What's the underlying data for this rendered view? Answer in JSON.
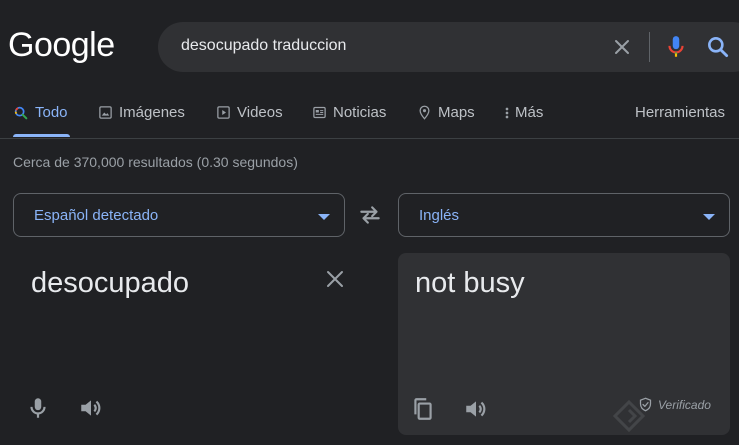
{
  "logo": {
    "text": "Google"
  },
  "search": {
    "query": "desocupado traduccion"
  },
  "tabs": [
    {
      "label": "Todo",
      "icon": "search-icon",
      "active": true
    },
    {
      "label": "Imágenes",
      "icon": "image-icon"
    },
    {
      "label": "Videos",
      "icon": "play-icon"
    },
    {
      "label": "Noticias",
      "icon": "newspaper-icon"
    },
    {
      "label": "Maps",
      "icon": "map-pin-icon"
    },
    {
      "label": "Más",
      "icon": "more-vert-icon"
    }
  ],
  "tools_label": "Herramientas",
  "results_count": "Cerca de 370,000 resultados (0.30 segundos)",
  "translator": {
    "source_language": "Español detectado",
    "target_language": "Inglés",
    "source_text": "desocupado",
    "target_text": "not busy",
    "verified_label": "Verificado"
  },
  "colors": {
    "background": "#202124",
    "accent": "#8ab4f8",
    "panel": "#303134",
    "text": "#e8eaed",
    "muted": "#9aa0a6"
  }
}
